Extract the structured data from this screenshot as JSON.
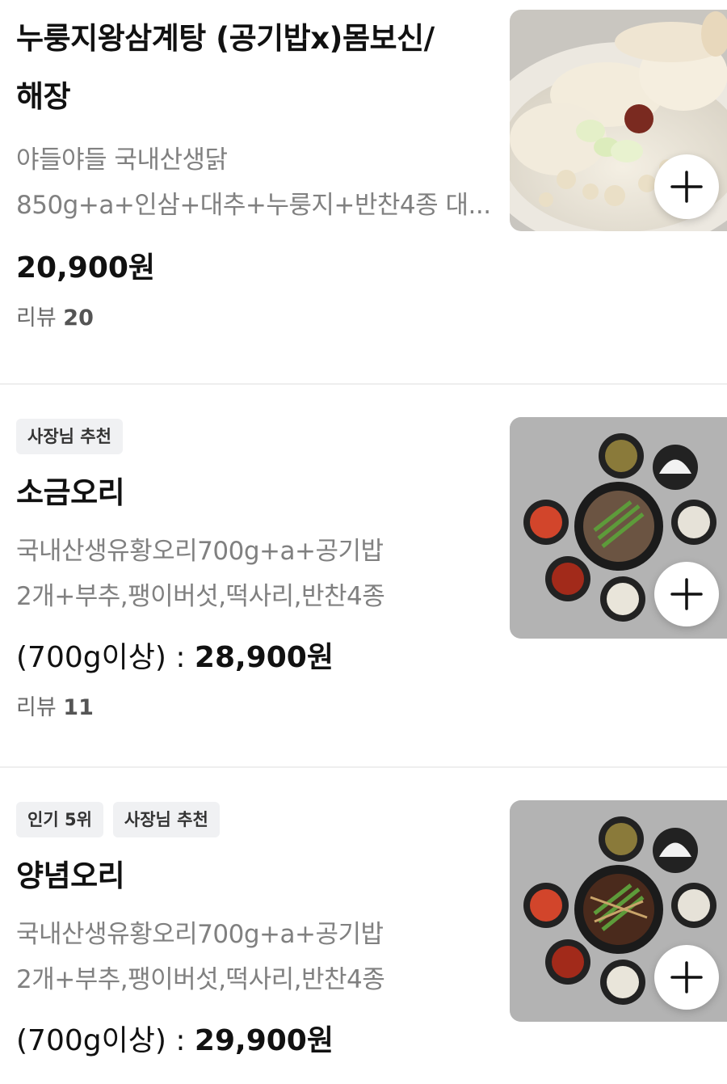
{
  "menu_items": [
    {
      "badges": [],
      "title_line1": "누룽지왕삼계탕 (공기밥x)몸보신/",
      "title_line2": "해장",
      "desc_line1": "야들야들 국내산생닭",
      "desc_line2": "850g+a+인삼+대추+누룽지+반찬4종 대...",
      "price_prefix": "",
      "price": "20,900원",
      "review_label": "리뷰",
      "review_count": "20",
      "image_icon": "samgyetang-photo"
    },
    {
      "badges": [
        "사장님 추천"
      ],
      "title_line1": "소금오리",
      "desc_line1": "국내산생유황오리700g+a+공기밥",
      "desc_line2": "2개+부추,팽이버섯,떡사리,반찬4종",
      "price_prefix": "(700g이상) : ",
      "price": "28,900원",
      "review_label": "리뷰",
      "review_count": "11",
      "image_icon": "salt-duck-photo"
    },
    {
      "badges": [
        "인기 5위",
        "사장님 추천"
      ],
      "title_line1": "양념오리",
      "desc_line1": "국내산생유황오리700g+a+공기밥",
      "desc_line2": "2개+부추,팽이버섯,떡사리,반찬4종",
      "price_prefix": "(700g이상) : ",
      "price": "29,900원",
      "image_icon": "seasoned-duck-photo"
    }
  ],
  "add_button_icon": "plus-icon",
  "colors": {
    "title": "#111111",
    "description": "#808080",
    "badge_bg": "#f0f1f3",
    "divider": "#eeeeee"
  }
}
